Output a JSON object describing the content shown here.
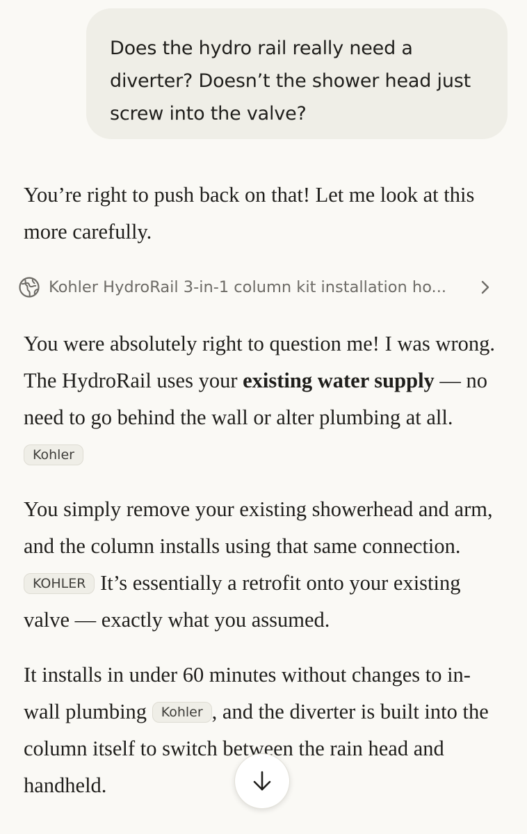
{
  "user_message": {
    "text": "Does the hydro rail really need a diverter? Doesn’t the shower head just screw into the valve?"
  },
  "assistant": {
    "intro": "You’re right to push back on that! Let me look at this more carefully.",
    "source": {
      "icon": "globe-icon",
      "label": "Kohler HydroRail 3-in-1 column kit installation ho...",
      "chevron": "chevron-right-icon"
    },
    "p1": {
      "t1": "You were absolutely right to question me! I was wrong. The HydroRail uses your ",
      "bold": "existing water supply",
      "t2": " — no need to go behind the wall or alter plumbing at all. ",
      "cite": "Kohler"
    },
    "p2": {
      "t1": "You simply remove your existing showerhead and arm, and the column installs using that same connection. ",
      "cite": "KOHLER",
      "t2": " It’s essentially a retrofit onto your existing valve — exactly what you assumed."
    },
    "p3": {
      "t1": "It installs in under 60 minutes without changes to in-wall plumbing ",
      "cite": "Kohler",
      "t2": ", and the diverter is built into the column itself to switch between the rain head and handheld."
    }
  },
  "scroll_button": {
    "icon": "arrow-down-icon"
  },
  "colors": {
    "background": "#faf9f5",
    "bubble": "#efeee7",
    "text": "#1f1e1b",
    "muted": "#6d6b66"
  }
}
